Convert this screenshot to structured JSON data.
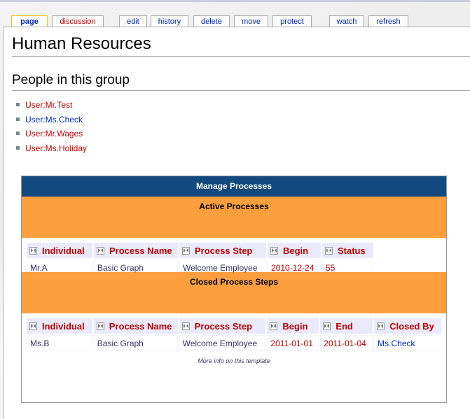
{
  "tabs": [
    {
      "label": "page",
      "selected": true
    },
    {
      "label": "discussion"
    },
    {
      "label": "edit"
    },
    {
      "label": "history"
    },
    {
      "label": "delete"
    },
    {
      "label": "move"
    },
    {
      "label": "protect"
    },
    {
      "label": "watch"
    },
    {
      "label": "refresh"
    }
  ],
  "page_title": "Human Resources",
  "section_title": "People in this group",
  "people": [
    {
      "label": "User:Mr.Test",
      "link_color": "red"
    },
    {
      "label": "User:Ms.Check",
      "link_color": "blue"
    },
    {
      "label": "User:Mr.Wages",
      "link_color": "red"
    },
    {
      "label": "User:Ms.Holiday",
      "link_color": "red"
    }
  ],
  "manage": {
    "title": "Manage Processes",
    "active": {
      "title": "Active Processes",
      "columns": [
        "Individual",
        "Process Name",
        "Process Step",
        "Begin",
        "Status"
      ],
      "rows": [
        [
          "Mr.A",
          "Basic Graph",
          "Welcome Employee",
          "2010-12-24",
          "55"
        ]
      ]
    },
    "closed": {
      "title": "Closed Process Steps",
      "columns": [
        "Individual",
        "Process Name",
        "Process Step",
        "Begin",
        "End",
        "Closed By"
      ],
      "rows": [
        [
          "Ms.B",
          "Basic Graph",
          "Welcome Employee",
          "2011-01-01",
          "2011-01-04",
          "Ms.Check"
        ]
      ]
    },
    "footer_link": "More info on this template"
  },
  "colors": {
    "header_bg": "#124a80",
    "section_bg": "#fd9f3f",
    "link_red": "#ba0000",
    "link_blue": "#002bb8"
  }
}
